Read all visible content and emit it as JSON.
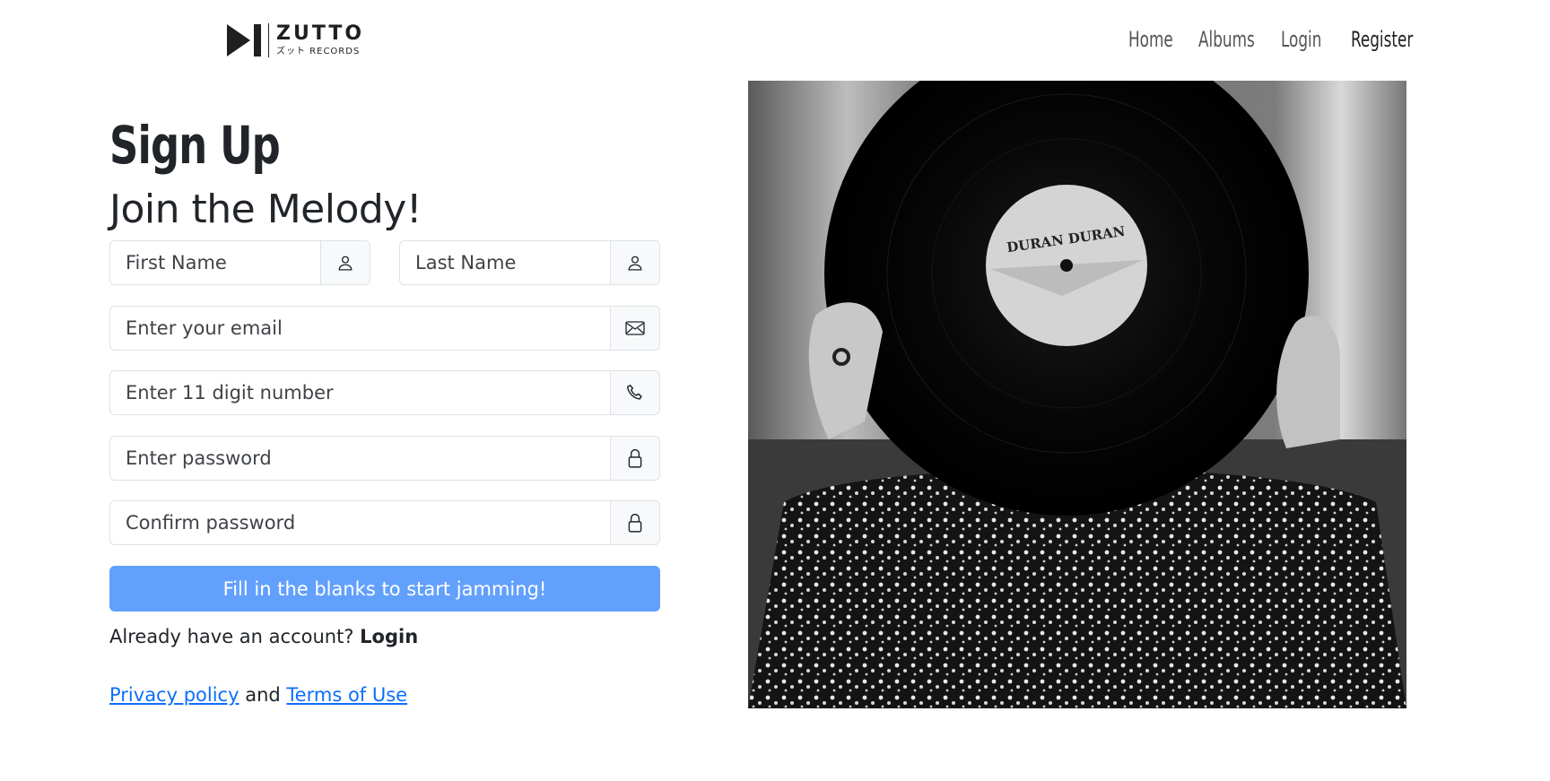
{
  "brand": {
    "name": "ZUTTO",
    "sub": "ズット RECORDS"
  },
  "nav": {
    "items": [
      "Home",
      "Albums",
      "Login",
      "Register"
    ]
  },
  "form": {
    "title": "Sign Up",
    "subtitle": "Join the Melody!",
    "first_name_placeholder": "First Name",
    "last_name_placeholder": "Last Name",
    "email_placeholder": "Enter your email",
    "phone_placeholder": "Enter 11 digit number",
    "password_placeholder": "Enter password",
    "confirm_placeholder": "Confirm password",
    "submit_label": "Fill in the blanks to start jamming!",
    "already_text": "Already have an account?",
    "login_label": "Login",
    "privacy_label": "Privacy policy",
    "and_text": "and",
    "terms_label": "Terms of Use"
  },
  "hero": {
    "record_label": "DURAN DURAN"
  },
  "colors": {
    "primary_button": "#62a0fd",
    "link": "#0d6efd"
  }
}
